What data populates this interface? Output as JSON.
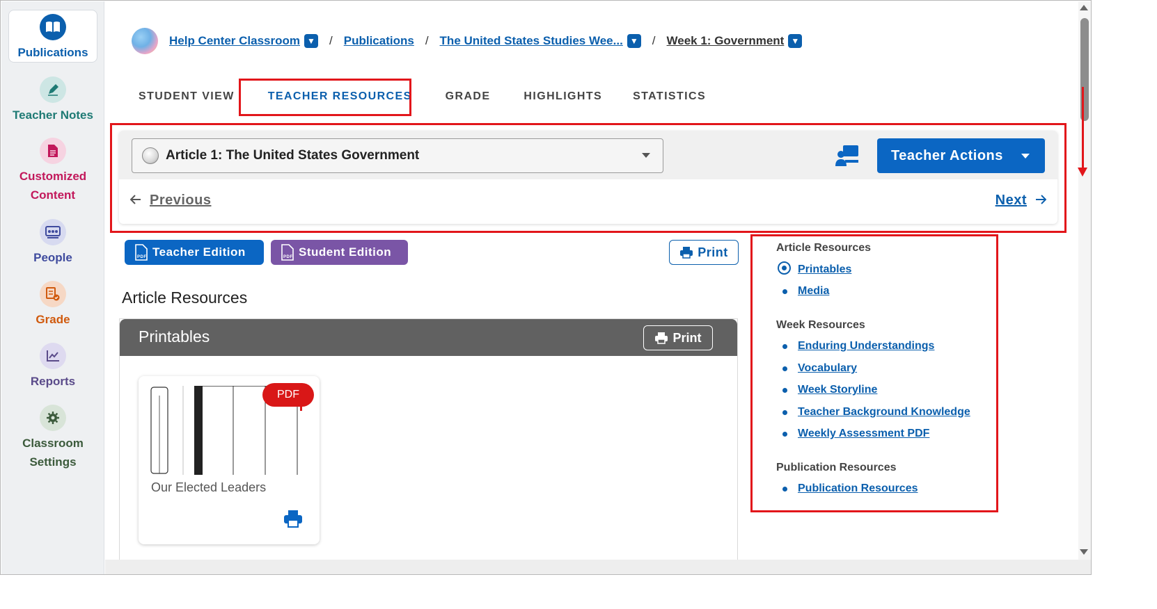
{
  "sidebar": {
    "items": [
      {
        "label": "Publications",
        "icon": "book-icon",
        "color": "#0b5fad"
      },
      {
        "label": "Teacher Notes",
        "icon": "pen-icon",
        "color": "#1e7a74"
      },
      {
        "label": "Customized",
        "label2": "Content",
        "icon": "document-icon",
        "color": "#c2185b"
      },
      {
        "label": "People",
        "icon": "people-icon",
        "color": "#3f4b9e"
      },
      {
        "label": "Grade",
        "icon": "grade-icon",
        "color": "#d05a0e"
      },
      {
        "label": "Reports",
        "icon": "chart-icon",
        "color": "#5a4b8a"
      },
      {
        "label": "Classroom",
        "label2": "Settings",
        "icon": "gear-icon",
        "color": "#3b5a3b"
      }
    ]
  },
  "breadcrumb": {
    "items": [
      "Help Center Classroom",
      "Publications",
      "The United States Studies Wee...",
      "Week 1: Government"
    ],
    "separator": "/"
  },
  "tabs": [
    "STUDENT VIEW",
    "TEACHER RESOURCES",
    "GRADE",
    "HIGHLIGHTS",
    "STATISTICS"
  ],
  "active_tab": "TEACHER RESOURCES",
  "article_selector": {
    "value": "Article 1: The United States Government",
    "teacher_actions_label": "Teacher Actions",
    "previous_label": "Previous",
    "next_label": "Next"
  },
  "editions": {
    "teacher_label": "Teacher Edition",
    "student_label": "Student Edition",
    "print_label": "Print"
  },
  "main": {
    "section_title": "Article Resources",
    "printables_title": "Printables",
    "printables_print_label": "Print",
    "document": {
      "name": "Our Elected Leaders",
      "badge": "PDF"
    }
  },
  "resources": {
    "article_heading": "Article Resources",
    "article_links": [
      "Printables",
      "Media"
    ],
    "week_heading": "Week Resources",
    "week_links": [
      "Enduring Understandings",
      "Vocabulary",
      "Week Storyline",
      "Teacher Background Knowledge",
      "Weekly Assessment PDF"
    ],
    "publication_heading": "Publication Resources",
    "publication_links": [
      "Publication Resources"
    ]
  },
  "colors": {
    "brand_blue": "#0b66c3",
    "link_blue": "#0b5fad",
    "student_purple": "#7a55a6",
    "highlight_red": "#e2161b",
    "pdf_red": "#d91717"
  }
}
